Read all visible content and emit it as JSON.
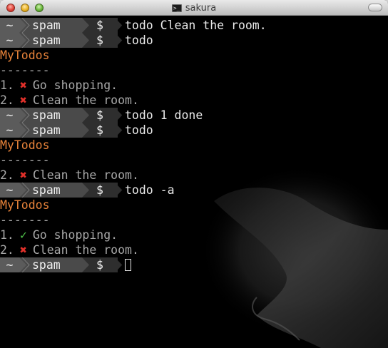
{
  "window": {
    "title": "sakura",
    "title_icon": "terminal-icon"
  },
  "prompt": {
    "tilde": "~",
    "user": "spam",
    "symbol": "$"
  },
  "commands": [
    "todo Clean the room.",
    "todo",
    "todo 1 done",
    "todo",
    "todo -a"
  ],
  "outputs": {
    "list1": {
      "heading": "MyTodos",
      "rule": "-------",
      "items": [
        {
          "num": "1.",
          "mark": "✖",
          "text": "Go shopping."
        },
        {
          "num": "2.",
          "mark": "✖",
          "text": "Clean the room."
        }
      ]
    },
    "list2": {
      "heading": "MyTodos",
      "rule": "-------",
      "items": [
        {
          "num": "2.",
          "mark": "✖",
          "text": "Clean the room."
        }
      ]
    },
    "list3": {
      "heading": "MyTodos",
      "rule": "-------",
      "items": [
        {
          "num": "1.",
          "mark": "✓",
          "text": "Go shopping."
        },
        {
          "num": "2.",
          "mark": "✖",
          "text": "Clean the room."
        }
      ]
    }
  },
  "colors": {
    "heading": "#e8833a",
    "done": "#4fc34a",
    "undone": "#e0302a"
  }
}
